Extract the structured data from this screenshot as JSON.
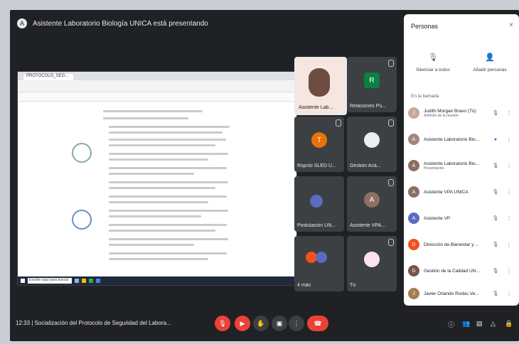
{
  "header": {
    "presenter_text": "Asistente Laboratorio Biología UNICA está presentando"
  },
  "shared_window": {
    "tab_title": "PROTOCOLO_SEG...",
    "search_placeholder": "Escribe aquí para buscar"
  },
  "tiles": [
    {
      "name": "Asistente Lab...",
      "initial": "",
      "color": "#f0c7c0"
    },
    {
      "name": "Relaciones Pú...",
      "initial": "R",
      "color": "#0b8043"
    },
    {
      "name": "Rspcto SLED U...",
      "initial": "T",
      "color": "#e8710a"
    },
    {
      "name": "Gestión Acá...",
      "initial": "",
      "color": "#3c4043"
    },
    {
      "name": "Postulación UN...",
      "initial": "",
      "color": "#5f6368"
    },
    {
      "name": "Asistente VPA...",
      "initial": "A",
      "color": "#8d6e63"
    },
    {
      "name": "4 más",
      "initial": "",
      "color": "#3c4043"
    },
    {
      "name": "Tú",
      "initial": "",
      "color": "#3c4043"
    }
  ],
  "people_panel": {
    "title": "Personas",
    "close_icon": "close-icon",
    "actions": [
      {
        "label": "Silenciar a todos",
        "icon": "mic-off-icon"
      },
      {
        "label": "Añadir personas",
        "icon": "person-add-icon"
      }
    ],
    "section_label": "En la llamada",
    "participants": [
      {
        "name": "Judith Morgan Bravo (Tú)",
        "sub": "Anfitrión de la reunión",
        "color": "#c9a896",
        "initial": "J"
      },
      {
        "name": "Asistente Laboratorio Bio...",
        "sub": "",
        "color": "#a1887f",
        "initial": "A"
      },
      {
        "name": "Asistente Laboratorio Bio...",
        "sub": "Presentando",
        "color": "#8d6e63",
        "initial": "A"
      },
      {
        "name": "Asistente VPA UNICA",
        "sub": "",
        "color": "#8d6e63",
        "initial": "A"
      },
      {
        "name": "Asistente VP",
        "sub": "",
        "color": "#5c6bc0",
        "initial": "A"
      },
      {
        "name": "Dirección de Bienestar y ...",
        "sub": "",
        "color": "#f4511e",
        "initial": "D"
      },
      {
        "name": "Gestión de la Calidad UN...",
        "sub": "",
        "color": "#795548",
        "initial": "G"
      },
      {
        "name": "Javier Orlando Rodas Ve...",
        "sub": "",
        "color": "#a67c52",
        "initial": "J"
      }
    ]
  },
  "bottom": {
    "time": "12:33",
    "separator": "|",
    "meeting_title": "Socialización del Protocolo de Seguridad del Labora..."
  }
}
